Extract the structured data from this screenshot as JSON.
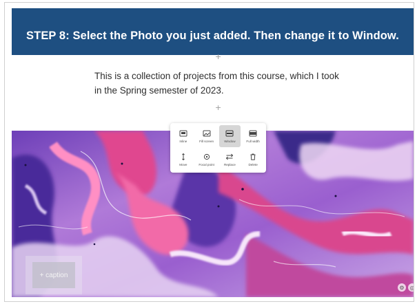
{
  "banner": {
    "text": "STEP 8: Select the Photo you just added. Then change it to Window."
  },
  "content": {
    "paragraph": "This is a collection of projects from this course, which I took in the Spring semester of 2023."
  },
  "add_block": {
    "symbol": "+"
  },
  "toolbar": {
    "buttons": [
      {
        "label": "Inline",
        "icon": "inline-icon",
        "active": false
      },
      {
        "label": "Fill screen",
        "icon": "fill-screen-icon",
        "active": false
      },
      {
        "label": "Window",
        "icon": "window-icon",
        "active": true
      },
      {
        "label": "Full width",
        "icon": "full-width-icon",
        "active": false
      },
      {
        "label": "Move",
        "icon": "move-icon",
        "active": false
      },
      {
        "label": "Focal point",
        "icon": "focal-point-icon",
        "active": false
      },
      {
        "label": "Replace",
        "icon": "replace-icon",
        "active": false
      },
      {
        "label": "Delete",
        "icon": "delete-icon",
        "active": false
      }
    ]
  },
  "photo": {
    "caption_placeholder": "+ caption"
  },
  "colors": {
    "banner": "#1e4f81",
    "active_button": "#d6d6d6"
  }
}
